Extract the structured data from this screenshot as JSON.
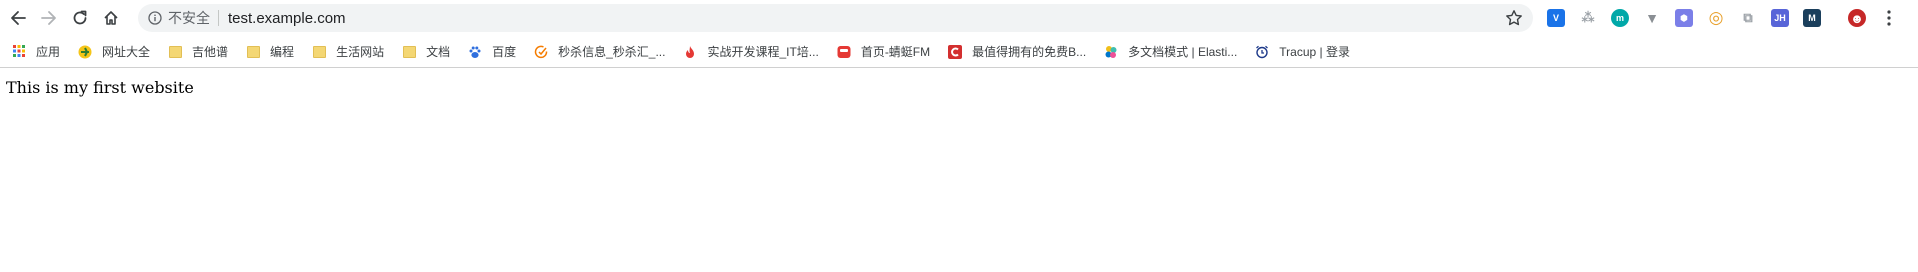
{
  "toolbar": {
    "back_icon": "arrow-left-icon",
    "forward_icon": "arrow-right-icon",
    "reload_icon": "reload-icon",
    "home_icon": "home-icon"
  },
  "omnibox": {
    "security_label": "不安全",
    "url": "test.example.com",
    "bookmark_star_icon": "star-outline-icon"
  },
  "extensions": [
    {
      "name": "v-extension-icon",
      "color": "#1a73e8",
      "glyph": "V"
    },
    {
      "name": "sitemap-extension-icon",
      "color": "#9aa0a6",
      "glyph": "⁂"
    },
    {
      "name": "m-extension-icon",
      "color": "#00a8a8",
      "glyph": "m"
    },
    {
      "name": "vue-extension-icon",
      "color": "#8a8f94",
      "glyph": "▼"
    },
    {
      "name": "hex-extension-icon",
      "color": "#7b7fe8",
      "glyph": "⬢"
    },
    {
      "name": "color-ring-extension-icon",
      "color": "#e8a02b",
      "glyph": "◎"
    },
    {
      "name": "screen-extension-icon",
      "color": "#9aa0a6",
      "glyph": "⧉"
    },
    {
      "name": "jh-extension-icon",
      "color": "#5865d8",
      "glyph": "JH"
    },
    {
      "name": "m-dark-extension-icon",
      "color": "#1b3f5c",
      "glyph": "M"
    },
    {
      "name": "spider-avatar-icon",
      "color": "#c62828",
      "glyph": "☻"
    }
  ],
  "bookmarks": [
    {
      "label": "应用",
      "icon": "apps-grid-icon"
    },
    {
      "label": "网址大全",
      "icon": "globe-icon"
    },
    {
      "label": "吉他谱",
      "icon": "folder-icon"
    },
    {
      "label": "编程",
      "icon": "folder-icon"
    },
    {
      "label": "生活网站",
      "icon": "folder-icon"
    },
    {
      "label": "文档",
      "icon": "folder-icon"
    },
    {
      "label": "百度",
      "icon": "baidu-paw-icon"
    },
    {
      "label": "秒杀信息_秒杀汇_...",
      "icon": "check-circle-icon"
    },
    {
      "label": "实战开发课程_IT培...",
      "icon": "flame-icon"
    },
    {
      "label": "首页-蜻蜓FM",
      "icon": "radio-icon"
    },
    {
      "label": "最值得拥有的免费B...",
      "icon": "c-logo-icon"
    },
    {
      "label": "多文档模式 | Elasti...",
      "icon": "elastic-icon"
    },
    {
      "label": "Tracup | 登录",
      "icon": "alarm-clock-icon"
    }
  ],
  "page": {
    "text": "This is my first website"
  }
}
